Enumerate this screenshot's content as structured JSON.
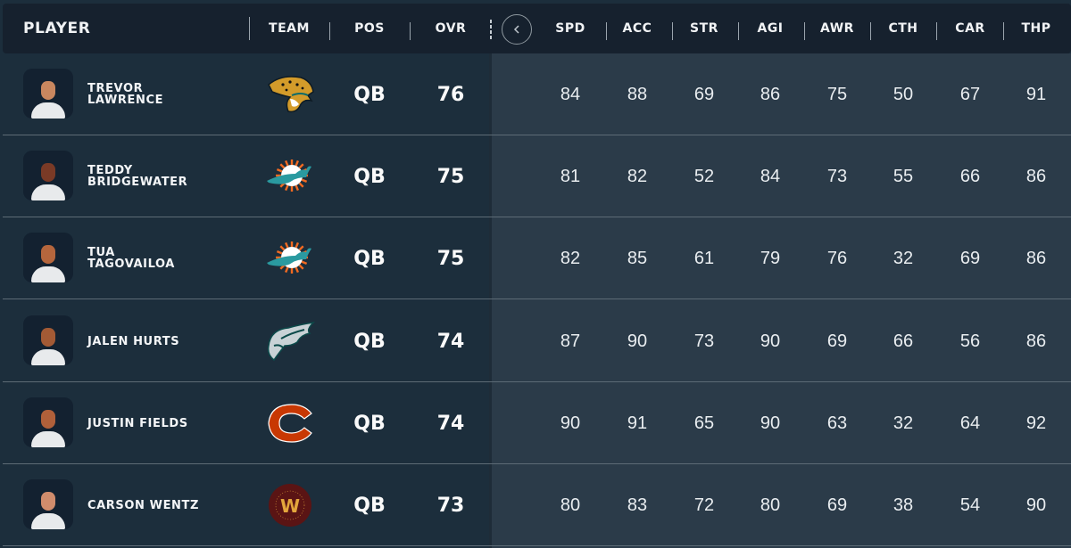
{
  "header": {
    "player": "PLAYER",
    "team": "TEAM",
    "pos": "POS",
    "ovr": "OVR",
    "collapse_icon": "chevron-left-icon",
    "stats": [
      "SPD",
      "ACC",
      "STR",
      "AGI",
      "AWR",
      "CTH",
      "CAR",
      "THP"
    ]
  },
  "players": [
    {
      "name_line1": "TREVOR",
      "name_line2": "LAWRENCE",
      "team": "Jacksonville Jaguars",
      "team_logo": "jaguars-logo",
      "pos": "QB",
      "ovr": "76",
      "stats": [
        "84",
        "88",
        "69",
        "86",
        "75",
        "50",
        "67",
        "91"
      ],
      "skin": "#c9875f"
    },
    {
      "name_line1": "TEDDY",
      "name_line2": "BRIDGEWATER",
      "team": "Miami Dolphins",
      "team_logo": "dolphins-logo",
      "pos": "QB",
      "ovr": "75",
      "stats": [
        "81",
        "82",
        "52",
        "84",
        "73",
        "55",
        "66",
        "86"
      ],
      "skin": "#7a3a26"
    },
    {
      "name_line1": "TUA",
      "name_line2": "TAGOVAILOA",
      "team": "Miami Dolphins",
      "team_logo": "dolphins-logo",
      "pos": "QB",
      "ovr": "75",
      "stats": [
        "82",
        "85",
        "61",
        "79",
        "76",
        "32",
        "69",
        "86"
      ],
      "skin": "#b5663d"
    },
    {
      "name_line1": "JALEN HURTS",
      "name_line2": "",
      "team": "Philadelphia Eagles",
      "team_logo": "eagles-logo",
      "pos": "QB",
      "ovr": "74",
      "stats": [
        "87",
        "90",
        "73",
        "90",
        "69",
        "66",
        "56",
        "86"
      ],
      "skin": "#a35a35"
    },
    {
      "name_line1": "JUSTIN FIELDS",
      "name_line2": "",
      "team": "Chicago Bears",
      "team_logo": "bears-logo",
      "pos": "QB",
      "ovr": "74",
      "stats": [
        "90",
        "91",
        "65",
        "90",
        "63",
        "32",
        "64",
        "92"
      ],
      "skin": "#b0603a"
    },
    {
      "name_line1": "CARSON WENTZ",
      "name_line2": "",
      "team": "Washington Football Team",
      "team_logo": "washington-logo",
      "pos": "QB",
      "ovr": "73",
      "stats": [
        "80",
        "83",
        "72",
        "80",
        "69",
        "38",
        "54",
        "90"
      ],
      "skin": "#d08c6c"
    }
  ],
  "colors": {
    "header_bg": "#16212e",
    "fixed_bg": "#1c2e3c",
    "stats_bg": "#2b3b49",
    "jaguars_gold": "#d39b2a",
    "dolphins_aqua": "#2a9aa0",
    "dolphins_orange": "#f26a21",
    "bears_orange": "#c83803",
    "washington_burgundy": "#5a1414",
    "washington_gold": "#e3a63c"
  }
}
